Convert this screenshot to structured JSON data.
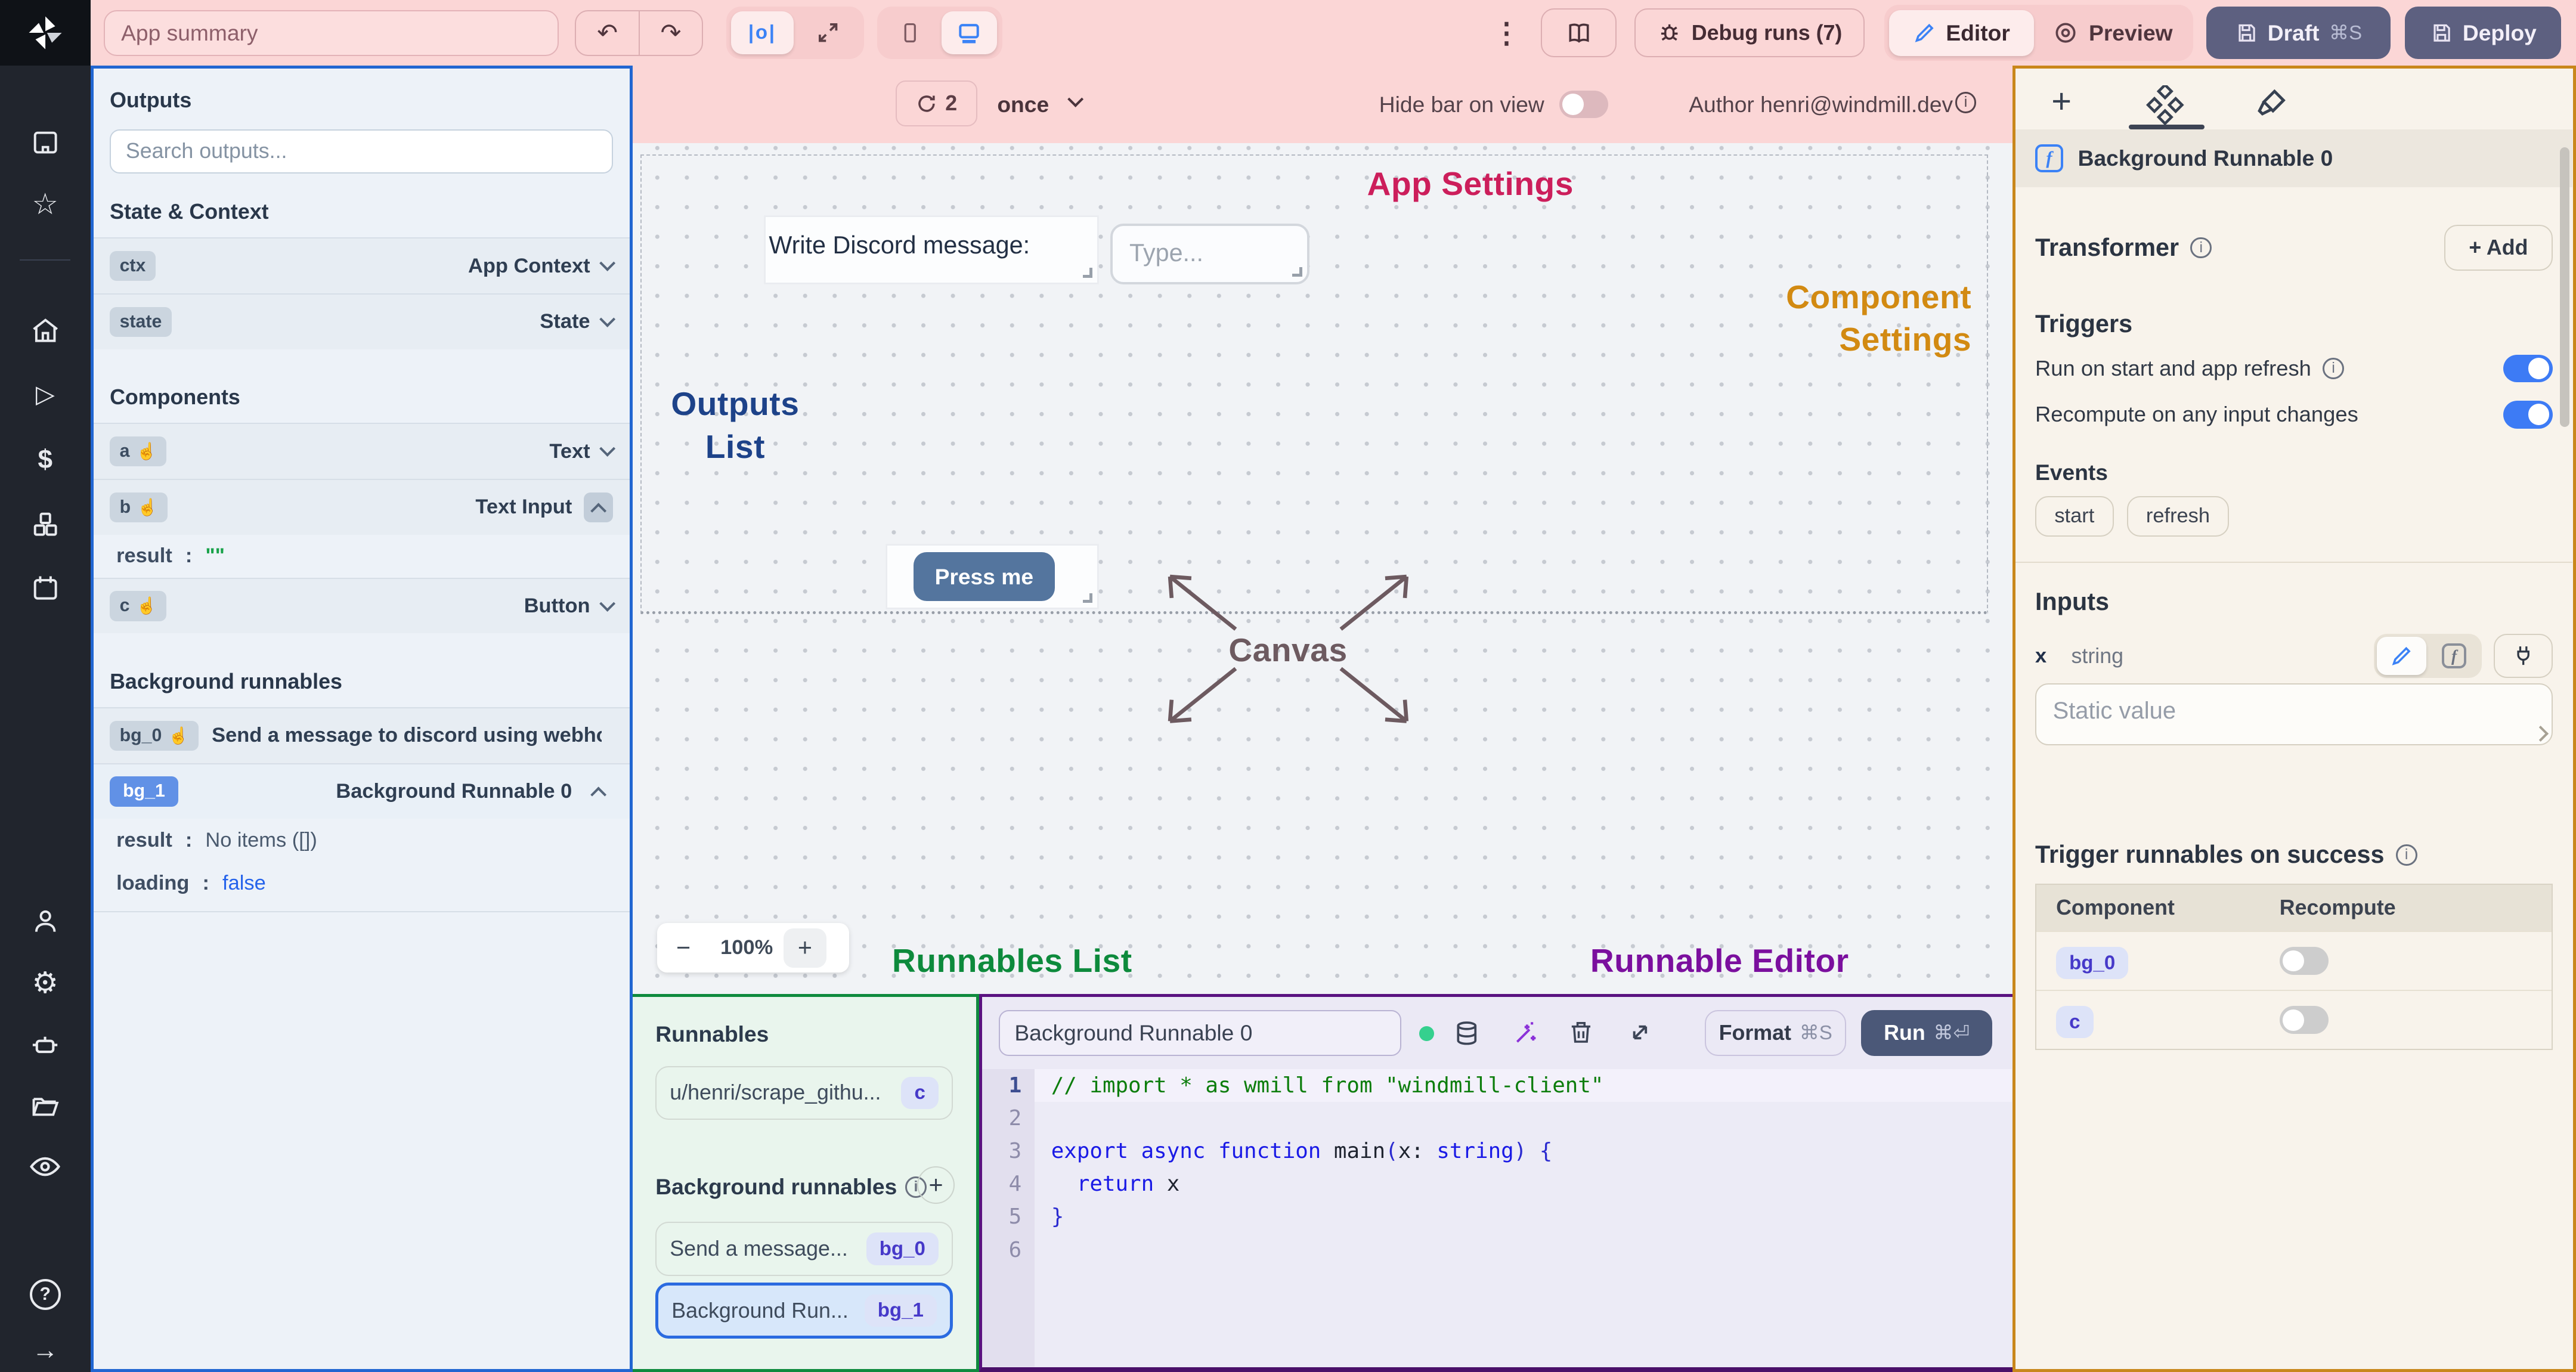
{
  "header": {
    "app_summary_placeholder": "App summary",
    "debug_runs_label": "Debug runs (7)",
    "editor_label": "Editor",
    "preview_label": "Preview",
    "draft_label": "Draft",
    "draft_shortcut": "⌘S",
    "deploy_label": "Deploy",
    "icons": [
      "windmill-logo",
      "undo",
      "redo",
      "centered-layout",
      "fullscreen-layout",
      "mobile-view",
      "desktop-view",
      "kebab-menu",
      "docs-book",
      "debug-bug",
      "editor-pencil",
      "preview-eye",
      "save-floppy"
    ]
  },
  "left_nav": {
    "icons": [
      "building",
      "star",
      "home",
      "play",
      "dollar",
      "cubes",
      "calendar",
      "user",
      "settings",
      "robot",
      "folder",
      "eye",
      "help",
      "collapse-arrow"
    ]
  },
  "canvas_bar": {
    "refresh_count": "2",
    "frequency": "once",
    "hide_bar_label": "Hide bar on view",
    "author_label": "Author henri@windmill.dev"
  },
  "outputs_panel": {
    "title": "Outputs",
    "search_placeholder": "Search outputs...",
    "sections": {
      "state_context": "State & Context",
      "components": "Components",
      "background_runnables": "Background runnables"
    },
    "state_rows": [
      {
        "id": "ctx",
        "type": "App Context"
      },
      {
        "id": "state",
        "type": "State"
      }
    ],
    "component_rows": [
      {
        "id": "a",
        "type": "Text"
      },
      {
        "id": "b",
        "type": "Text Input"
      },
      {
        "id": "c",
        "type": "Button"
      }
    ],
    "b_expanded": {
      "key": "result",
      "colon": ":",
      "value": "\"\""
    },
    "bg_rows": [
      {
        "id": "bg_0",
        "label": "Send a message to discord using webhoo"
      },
      {
        "id": "bg_1",
        "label": "Background Runnable 0"
      }
    ],
    "bg1_expanded": [
      {
        "key": "result",
        "colon": ":",
        "value": "No items ([])"
      },
      {
        "key": "loading",
        "colon": ":",
        "value": "false"
      }
    ]
  },
  "canvas": {
    "annotations": {
      "app_settings": "App Settings",
      "component_settings_line1": "Component",
      "component_settings_line2": "Settings",
      "outputs_list_line1": "Outputs",
      "outputs_list_line2": "List",
      "canvas_label": "Canvas",
      "runnables_list": "Runnables List",
      "runnable_editor": "Runnable Editor"
    },
    "discord_label": "Write Discord message:",
    "type_placeholder": "Type...",
    "press_me_label": "Press me",
    "zoom": {
      "minus": "−",
      "level": "100%",
      "plus": "+"
    }
  },
  "runnables_panel": {
    "title": "Runnables",
    "items": [
      {
        "label": "u/henri/scrape_githu...",
        "badge": "c"
      }
    ],
    "bg_section_title": "Background runnables",
    "bg_items": [
      {
        "label": "Send a message...",
        "badge": "bg_0"
      },
      {
        "label": "Background Run...",
        "badge": "bg_1"
      }
    ]
  },
  "editor_panel": {
    "name_value": "Background Runnable 0",
    "format_label": "Format",
    "format_shortcut": "⌘S",
    "run_label": "Run",
    "run_shortcut": "⌘⏎",
    "toolbar_icons": [
      "status-dot",
      "database",
      "magic-wand",
      "trash",
      "expand"
    ],
    "code_lines": [
      [
        {
          "t": "// import * as wmill from \"windmill-client\"",
          "c": "cm"
        }
      ],
      [],
      [
        {
          "t": "export",
          "c": "kw"
        },
        {
          "t": " ",
          "c": "pl"
        },
        {
          "t": "async",
          "c": "kw"
        },
        {
          "t": " ",
          "c": "pl"
        },
        {
          "t": "function",
          "c": "kw"
        },
        {
          "t": " ",
          "c": "pl"
        },
        {
          "t": "main",
          "c": "fn"
        },
        {
          "t": "(",
          "c": "pn"
        },
        {
          "t": "x",
          "c": "pl"
        },
        {
          "t": ": ",
          "c": "pl"
        },
        {
          "t": "string",
          "c": "kw"
        },
        {
          "t": ")",
          "c": "pn"
        },
        {
          "t": " {",
          "c": "pn"
        }
      ],
      [
        {
          "t": "  ",
          "c": "pl"
        },
        {
          "t": "return",
          "c": "kw"
        },
        {
          "t": " x",
          "c": "pl"
        }
      ],
      [
        {
          "t": "}",
          "c": "pn"
        }
      ],
      []
    ]
  },
  "right_panel": {
    "tab_icons": [
      "add-component",
      "components-diamonds",
      "theme-brush"
    ],
    "component_title": "Background Runnable 0",
    "transformer_label": "Transformer",
    "add_label": "+ Add",
    "triggers_label": "Triggers",
    "run_on_start_label": "Run on start and app refresh",
    "recompute_label": "Recompute on any input changes",
    "events_label": "Events",
    "event_buttons": [
      "start",
      "refresh"
    ],
    "inputs_label": "Inputs",
    "input_row": {
      "name": "x",
      "type": "string"
    },
    "static_value_placeholder": "Static value",
    "trigger_success_label": "Trigger runnables on success",
    "table": {
      "headers": [
        "Component",
        "Recompute"
      ],
      "rows": [
        {
          "component": "bg_0"
        },
        {
          "component": "c"
        }
      ]
    }
  },
  "colors": {
    "topbar_pink": "#fbd6d6",
    "outputs_border_blue": "#2166d1",
    "right_border_orange": "#c9871b",
    "runnables_border_green": "#0f8a3e",
    "editor_border_purple": "#5a1280",
    "annotation_red": "#cc1e5b",
    "annotation_orange": "#d28a12",
    "annotation_navy": "#1d4289",
    "annotation_gray": "#6d5a60",
    "toggle_on_blue": "#3d7bf5",
    "press_me_blue": "#54759e"
  }
}
